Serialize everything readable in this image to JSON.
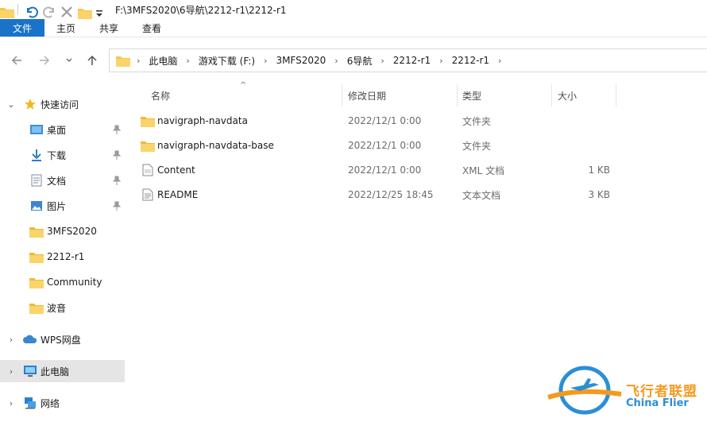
{
  "window": {
    "title": "F:\\3MFS2020\\6导航\\2212-r1\\2212-r1"
  },
  "ribbon": {
    "tabs": [
      {
        "label": "文件"
      },
      {
        "label": "主页"
      },
      {
        "label": "共享"
      },
      {
        "label": "查看"
      }
    ]
  },
  "address": {
    "breadcrumbs": [
      "此电脑",
      "游戏下载 (F:)",
      "3MFS2020",
      "6导航",
      "2212-r1",
      "2212-r1"
    ]
  },
  "sidebar": {
    "quick_access": "快速访问",
    "items": [
      {
        "label": "桌面",
        "icon": "desktop-icon",
        "pinned": true
      },
      {
        "label": "下载",
        "icon": "download-icon",
        "pinned": true
      },
      {
        "label": "文档",
        "icon": "document-icon",
        "pinned": true
      },
      {
        "label": "图片",
        "icon": "picture-icon",
        "pinned": true
      },
      {
        "label": "3MFS2020",
        "icon": "folder-icon",
        "pinned": false
      },
      {
        "label": "2212-r1",
        "icon": "folder-icon",
        "pinned": false
      },
      {
        "label": "Community",
        "icon": "folder-icon",
        "pinned": false
      },
      {
        "label": "波音",
        "icon": "folder-icon",
        "pinned": false
      }
    ],
    "wps": "WPS网盘",
    "this_pc": "此电脑",
    "network": "网络"
  },
  "table": {
    "columns": {
      "name": "名称",
      "modified": "修改日期",
      "type": "类型",
      "size": "大小"
    },
    "rows": [
      {
        "name": "navigraph-navdata",
        "modified": "2022/12/1 0:00",
        "type": "文件夹",
        "size": "",
        "icon": "folder-icon"
      },
      {
        "name": "navigraph-navdata-base",
        "modified": "2022/12/1 0:00",
        "type": "文件夹",
        "size": "",
        "icon": "folder-icon"
      },
      {
        "name": "Content",
        "modified": "2022/12/1 0:00",
        "type": "XML 文档",
        "size": "1 KB",
        "icon": "xml-file-icon"
      },
      {
        "name": "README",
        "modified": "2022/12/25 18:45",
        "type": "文本文档",
        "size": "3 KB",
        "icon": "text-file-icon"
      }
    ]
  },
  "watermark": {
    "line1": "飞行者联盟",
    "line2": "China Flier"
  },
  "colors": {
    "accent": "#1a73c8",
    "folder": "#f7c84a",
    "selected": "#e5e5e5"
  }
}
